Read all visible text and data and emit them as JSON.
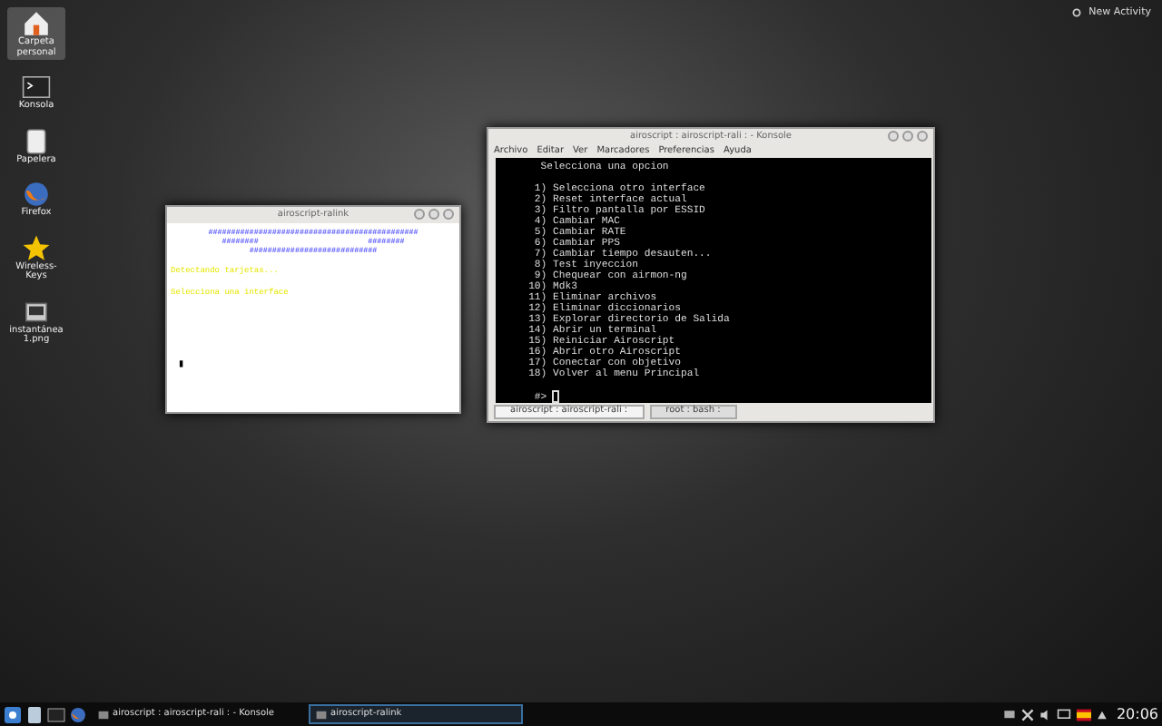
{
  "desktop_icons": [
    {
      "label": "Carpeta personal",
      "kind": "home",
      "selected": true
    },
    {
      "label": "Konsola",
      "kind": "terminal",
      "selected": false
    },
    {
      "label": "Papelera",
      "kind": "trash",
      "selected": false
    },
    {
      "label": "Firefox",
      "kind": "browser",
      "selected": false
    },
    {
      "label": "Wireless-Keys",
      "kind": "star",
      "selected": false
    },
    {
      "label": "instantánea1.png",
      "kind": "image",
      "selected": false
    }
  ],
  "activity_button": {
    "label": "New Activity"
  },
  "small_window": {
    "title": "airoscript-ralink",
    "banner_lines": [
      "##############################################",
      "########                        ########",
      "############################"
    ],
    "messages": [
      "Detectando tarjetas...",
      "Selecciona una interface"
    ],
    "cursor": "▮"
  },
  "konsole": {
    "title": "airoscript : airoscript-rali : - Konsole",
    "menu": [
      "Archivo",
      "Editar",
      "Ver",
      "Marcadores",
      "Preferencias",
      "Ayuda"
    ],
    "heading": "Selecciona una opcion",
    "options": [
      "1) Selecciona otro interface",
      "2) Reset interface actual",
      "3) Filtro pantalla por ESSID",
      "4) Cambiar MAC",
      "5) Cambiar RATE",
      "6) Cambiar PPS",
      "7) Cambiar tiempo desauten...",
      "8) Test inyeccion",
      "9) Chequear con airmon-ng",
      "10) Mdk3",
      "11) Eliminar archivos",
      "12) Eliminar diccionarios",
      "13) Explorar directorio de Salida",
      "14) Abrir un terminal",
      "15) Reiniciar Airoscript",
      "16) Abrir otro Airoscript",
      "17) Conectar con objetivo",
      "18) Volver al menu Principal"
    ],
    "prompt": "#>",
    "tabs": [
      {
        "label": "airoscript : airoscript-rali :",
        "selected": true
      },
      {
        "label": "root : bash :",
        "selected": false
      }
    ]
  },
  "taskbar": {
    "tasks": [
      {
        "label": "airoscript : airoscript-rali : - Konsole",
        "selected": false
      },
      {
        "label": "airoscript-ralink",
        "selected": true
      }
    ],
    "clock": "20:06"
  }
}
